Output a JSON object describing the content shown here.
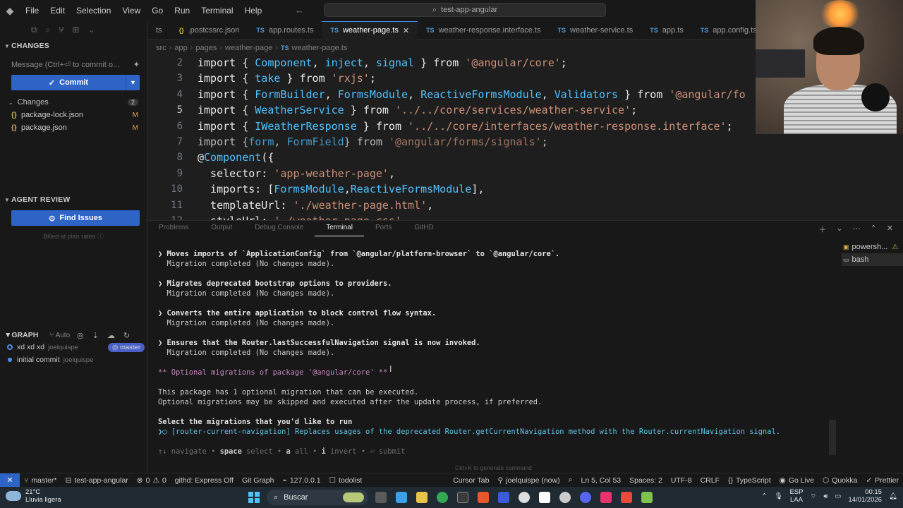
{
  "titlebar": {
    "menu": [
      "File",
      "Edit",
      "Selection",
      "View",
      "Go",
      "Run",
      "Terminal",
      "Help"
    ],
    "search_text": "test-app-angular"
  },
  "sidebar": {
    "changes_title": "CHANGES",
    "message_placeholder": "Message (Ctrl+⏎ to commit o...",
    "commit_label": "Commit",
    "changes_label": "Changes",
    "changes_count": "2",
    "files": [
      {
        "name": "package-lock.json",
        "status": "M"
      },
      {
        "name": "package.json",
        "status": "M"
      }
    ],
    "agent_review_title": "AGENT REVIEW",
    "find_issues_label": "Find Issues",
    "billed_text": "Billed at plan rates",
    "graph_title": "GRAPH",
    "graph_auto": "Auto",
    "commits": [
      {
        "message": "xd xd xd",
        "author": "joelquispe",
        "branch": "master"
      },
      {
        "message": "initial commit",
        "author": "joelquispe",
        "branch": ""
      }
    ]
  },
  "tabs": [
    {
      "icon": "",
      "label": "ts",
      "active": false
    },
    {
      "icon": "{}",
      "label": ".postcssrc.json",
      "active": false
    },
    {
      "icon": "TS",
      "label": "app.routes.ts",
      "active": false
    },
    {
      "icon": "TS",
      "label": "weather-page.ts",
      "active": true
    },
    {
      "icon": "TS",
      "label": "weather-response.interface.ts",
      "active": false
    },
    {
      "icon": "TS",
      "label": "weather-service.ts",
      "active": false
    },
    {
      "icon": "TS",
      "label": "app.ts",
      "active": false
    },
    {
      "icon": "TS",
      "label": "app.config.ts",
      "active": false
    }
  ],
  "breadcrumb": [
    "src",
    "app",
    "pages",
    "weather-page",
    "weather-page.ts"
  ],
  "editor": {
    "lines": [
      {
        "n": "2",
        "text": "import { Component, inject, signal } from '@angular/core';"
      },
      {
        "n": "3",
        "text": "import { take } from 'rxjs';"
      },
      {
        "n": "4",
        "text": "import { FormBuilder, FormsModule, ReactiveFormsModule, Validators } from '@angular/fo"
      },
      {
        "n": "5",
        "text": "import { WeatherService } from '../../core/services/weather-service';"
      },
      {
        "n": "6",
        "text": "import { IWeatherResponse } from '../../core/interfaces/weather-response.interface';"
      },
      {
        "n": "7",
        "text": "import {form, FormField} from '@angular/forms/signals';"
      },
      {
        "n": "8",
        "text": "@Component({"
      },
      {
        "n": "9",
        "text": "  selector: 'app-weather-page',"
      },
      {
        "n": "10",
        "text": "  imports: [FormsModule,ReactiveFormsModule],"
      },
      {
        "n": "11",
        "text": "  templateUrl: './weather-page.html',"
      },
      {
        "n": "12",
        "text": "  styleUrl: './weather-page.css'"
      }
    ]
  },
  "panel": {
    "tabs": [
      "Problems",
      "Output",
      "Debug Console",
      "Terminal",
      "Ports",
      "GitHD"
    ],
    "active_tab": "Terminal",
    "terminals": [
      "powersh...",
      "bash"
    ],
    "ctrl_k_hint": "Ctrl+K to generate command"
  },
  "terminal": {
    "migrations": [
      {
        "title": "Moves imports of `ApplicationConfig` from `@angular/platform-browser` to `@angular/core`.",
        "result": "Migration completed (No changes made)."
      },
      {
        "title": "Migrates deprecated bootstrap options to providers.",
        "result": "Migration completed (No changes made)."
      },
      {
        "title": "Converts the entire application to block control flow syntax.",
        "result": "Migration completed (No changes made)."
      },
      {
        "title": "Ensures that the Router.lastSuccessfulNavigation signal is now invoked.",
        "result": "Migration completed (No changes made)."
      }
    ],
    "optional_header_pre": "** Optional migrations of package ",
    "optional_header_pkg": "'@angular/core'",
    "optional_header_post": " **",
    "info1": "This package has 1 optional migration that can be executed.",
    "info2": "Optional migrations may be skipped and executed after the update process, if preferred.",
    "select_prompt": "Select the migrations that you'd like to run",
    "choice_tag": "[router-current-navigation]",
    "choice_desc": " Replaces usages of the deprecated Router.getCurrentNavigation method with the Router.currentNavigation signal.",
    "hint_nav": "↑↓ navigate • ",
    "hint_space": "space",
    "hint_select": " select • ",
    "hint_a": "a",
    "hint_all": " all • ",
    "hint_i": "i",
    "hint_invert": " invert • ",
    "hint_submit": "⏎ submit"
  },
  "statusbar": {
    "branch": "master*",
    "project": "test-app-angular",
    "errors": "0",
    "warnings": "0",
    "githd": "githd: Express Off",
    "git_graph": "Git Graph",
    "host": "127.0.0.1",
    "todolist": "todolist",
    "cursor_tab": "Cursor Tab",
    "user": "joelquispe (now)",
    "position": "Ln 5, Col 53",
    "spaces": "Spaces: 2",
    "encoding": "UTF-8",
    "eol": "CRLF",
    "language": "TypeScript",
    "go_live": "Go Live",
    "quokka": "Quokka",
    "prettier": "Prettier"
  },
  "taskbar": {
    "temperature": "21°C",
    "weather": "Lluvia ligera",
    "search_label": "Buscar",
    "lang1": "ESP",
    "lang2": "LAA",
    "time": "00:15",
    "date": "14/01/2026"
  }
}
